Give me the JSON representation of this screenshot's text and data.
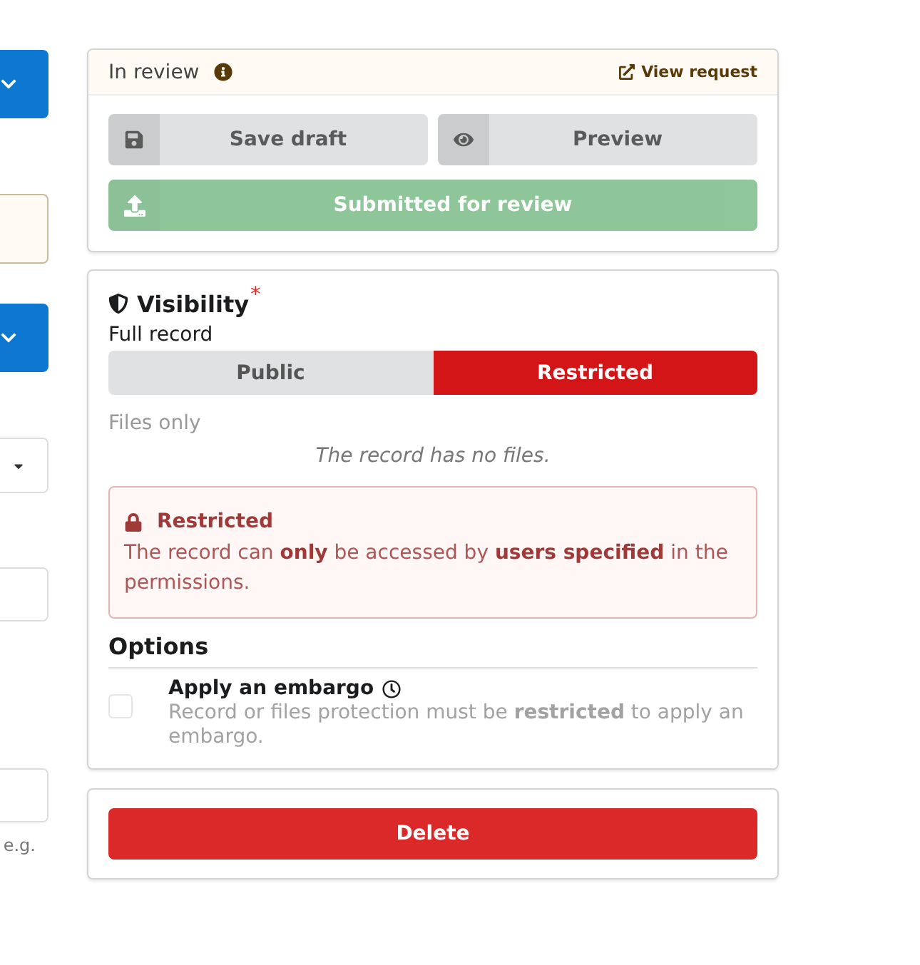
{
  "left_panel": {
    "items": [
      {
        "kind": "button"
      },
      {
        "kind": "notice"
      },
      {
        "kind": "button"
      },
      {
        "kind": "select"
      },
      {
        "kind": "input"
      },
      {
        "kind": "input"
      }
    ],
    "hint": "e.g."
  },
  "review": {
    "status": "In review",
    "link": "View request",
    "actions": [
      {
        "kind": "save",
        "label": "Save draft"
      },
      {
        "kind": "preview",
        "label": "Preview"
      }
    ],
    "submit": {
      "label": "Submitted for review",
      "disabled": true
    }
  },
  "visibility": {
    "title": "Visibility",
    "required_mark": "*",
    "full_record": {
      "label": "Full record",
      "options": [
        {
          "label": "Public",
          "selected": false
        },
        {
          "label": "Restricted",
          "selected": true
        }
      ]
    },
    "files_only": {
      "label": "Files only",
      "disabled": true,
      "note": "The record has no files."
    },
    "message": {
      "title": "Restricted",
      "text": "The record can **only** be accessed by **users specified** in the permissions."
    },
    "options": {
      "title": "Options",
      "items": [
        {
          "label": "Apply an embargo",
          "description": "Record or files protection must be **restricted** to apply an embargo.",
          "checked": false,
          "disabled": true
        }
      ]
    }
  },
  "delete": {
    "label": "Delete"
  }
}
